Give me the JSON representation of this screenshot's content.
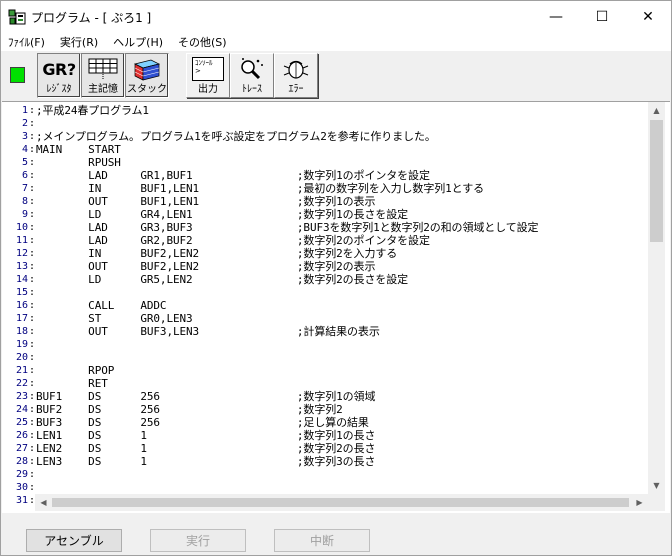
{
  "window": {
    "title": "プログラム - [ ぷろ1 ]",
    "minimize_glyph": "—",
    "maximize_glyph": "☐",
    "close_glyph": "✕"
  },
  "menu": [
    {
      "label": "ﾌｧｲﾙ(F)"
    },
    {
      "label": "実行(R)"
    },
    {
      "label": "ヘルプ(H)"
    },
    {
      "label": "その他(S)"
    }
  ],
  "toolbar": {
    "register_icon_text": "GR?",
    "register_label": "ﾚｼﾞｽﾀ",
    "memory_label": "主記憶",
    "stack_label": "スタック",
    "output_label": "出力",
    "output_icon_text": "ｺﾝｿｰﾙ",
    "trace_label": "ﾄﾚｰｽ",
    "error_label": "ｴﾗｰ"
  },
  "editor": {
    "lines": [
      {
        "n": "1",
        "code": ";平成24春プログラム1"
      },
      {
        "n": "2",
        "code": ""
      },
      {
        "n": "3",
        "code": ";メインプログラム。プログラム1を呼ぶ設定をプログラム2を参考に作りました。"
      },
      {
        "n": "4",
        "code": "MAIN    START"
      },
      {
        "n": "5",
        "code": "        RPUSH"
      },
      {
        "n": "6",
        "code": "        LAD     GR1,BUF1                ;数字列1のポインタを設定"
      },
      {
        "n": "7",
        "code": "        IN      BUF1,LEN1               ;最初の数字列を入力し数字列1とする"
      },
      {
        "n": "8",
        "code": "        OUT     BUF1,LEN1               ;数字列1の表示"
      },
      {
        "n": "9",
        "code": "        LD      GR4,LEN1                ;数字列1の長さを設定"
      },
      {
        "n": "10",
        "code": "        LAD     GR3,BUF3                ;BUF3を数字列1と数字列2の和の領域として設定"
      },
      {
        "n": "11",
        "code": "        LAD     GR2,BUF2                ;数字列2のポインタを設定"
      },
      {
        "n": "12",
        "code": "        IN      BUF2,LEN2               ;数字列2を入力する"
      },
      {
        "n": "13",
        "code": "        OUT     BUF2,LEN2               ;数字列2の表示"
      },
      {
        "n": "14",
        "code": "        LD      GR5,LEN2                ;数字列2の長さを設定"
      },
      {
        "n": "15",
        "code": ""
      },
      {
        "n": "16",
        "code": "        CALL    ADDC"
      },
      {
        "n": "17",
        "code": "        ST      GR0,LEN3"
      },
      {
        "n": "18",
        "code": "        OUT     BUF3,LEN3               ;計算結果の表示"
      },
      {
        "n": "19",
        "code": ""
      },
      {
        "n": "20",
        "code": ""
      },
      {
        "n": "21",
        "code": "        RPOP"
      },
      {
        "n": "22",
        "code": "        RET"
      },
      {
        "n": "23",
        "code": "BUF1    DS      256                     ;数字列1の領域"
      },
      {
        "n": "24",
        "code": "BUF2    DS      256                     ;数字列2"
      },
      {
        "n": "25",
        "code": "BUF3    DS      256                     ;足し算の結果"
      },
      {
        "n": "26",
        "code": "LEN1    DS      1                       ;数字列1の長さ"
      },
      {
        "n": "27",
        "code": "LEN2    DS      1                       ;数字列2の長さ"
      },
      {
        "n": "28",
        "code": "LEN3    DS      1                       ;数字列3の長さ"
      },
      {
        "n": "29",
        "code": ""
      },
      {
        "n": "30",
        "code": ""
      },
      {
        "n": "31",
        "code": ""
      }
    ]
  },
  "buttons": {
    "assemble": "アセンブル",
    "run": "実行",
    "stop": "中断"
  }
}
